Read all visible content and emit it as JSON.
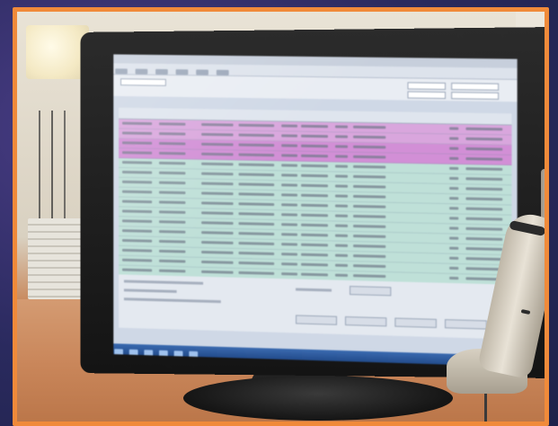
{
  "scene": {
    "subject": "",
    "frame_color": "#f08a3a",
    "background_color": "#2a2a5e"
  },
  "screen": {
    "window_title": "",
    "highlight_pink": "#d9a6dd",
    "highlight_teal": "#bfe0d8",
    "rows": [
      {
        "style": "pink"
      },
      {
        "style": "pink"
      },
      {
        "style": "pink-strong"
      },
      {
        "style": "pink-strong"
      },
      {
        "style": "teal"
      },
      {
        "style": "teal"
      },
      {
        "style": "teal"
      },
      {
        "style": "teal"
      },
      {
        "style": "teal"
      },
      {
        "style": "teal"
      },
      {
        "style": "teal"
      },
      {
        "style": "teal"
      },
      {
        "style": "teal"
      },
      {
        "style": "teal"
      },
      {
        "style": "teal"
      },
      {
        "style": "teal"
      }
    ]
  },
  "icons": [
    "barcode-scanner-icon",
    "monitor-icon"
  ]
}
